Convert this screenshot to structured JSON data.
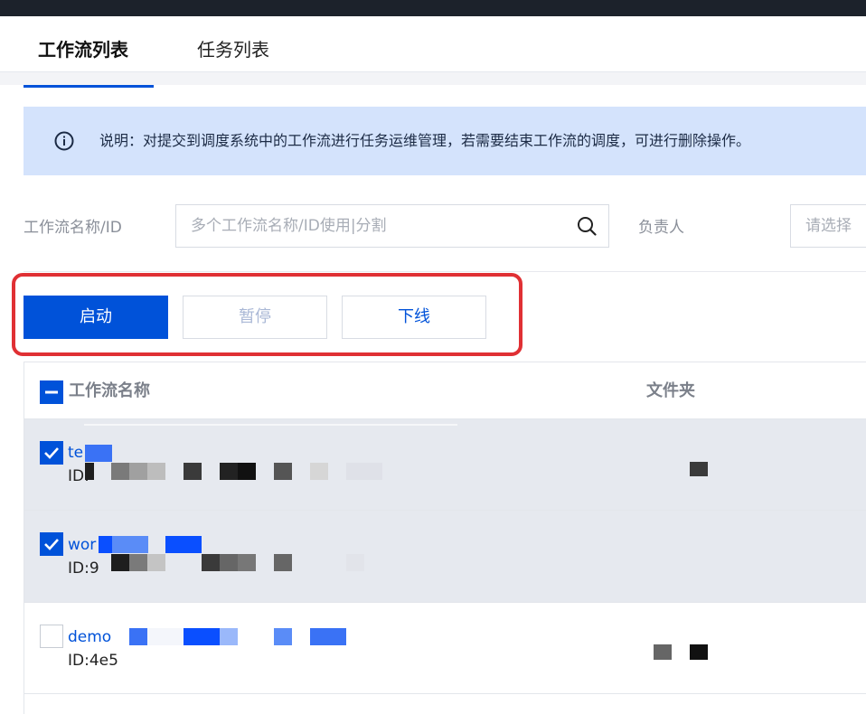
{
  "tabs": [
    {
      "label": "工作流列表",
      "active": true
    },
    {
      "label": "任务列表",
      "active": false
    }
  ],
  "notice": {
    "text": "说明：对提交到调度系统中的工作流进行任务运维管理，若需要结束工作流的调度，可进行删除操作。",
    "icon": "info-circle-icon"
  },
  "filters": {
    "name_label": "工作流名称/ID",
    "search_placeholder": "多个工作流名称/ID使用|分割",
    "owner_label": "负责人",
    "owner_placeholder": "请选择"
  },
  "actions": {
    "start_label": "启动",
    "pause_label": "暂停",
    "offline_label": "下线"
  },
  "table": {
    "columns": [
      "工作流名称",
      "文件夹"
    ],
    "rows": [
      {
        "name": "te",
        "id": "ID:",
        "selected": true
      },
      {
        "name": "wor",
        "id": "ID:9",
        "selected": true
      },
      {
        "name": "demo",
        "id": "ID:4e5",
        "selected": false
      }
    ]
  },
  "colors": {
    "primary": "#0052d9",
    "notice_bg": "#d4e3fc",
    "selected_row_bg": "#e6e9ef",
    "highlight": "#e03034"
  }
}
